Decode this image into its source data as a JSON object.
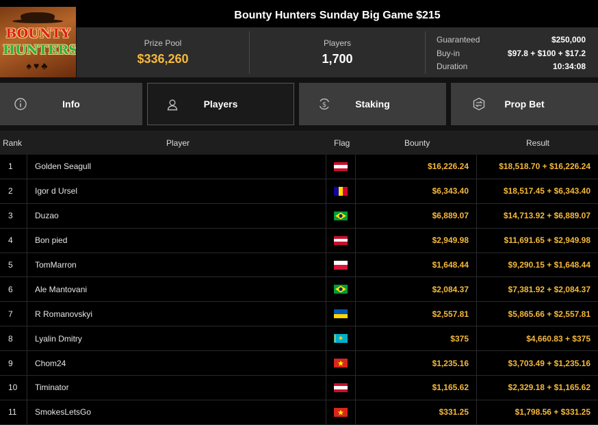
{
  "header": {
    "title": "Bounty Hunters Sunday Big Game $215",
    "logo_line1": "BOUNTY",
    "logo_line2": "HUNTERS"
  },
  "stats": {
    "prize_pool_label": "Prize Pool",
    "prize_pool_value": "$336,260",
    "players_label": "Players",
    "players_value": "1,700",
    "guaranteed_label": "Guaranteed",
    "guaranteed_value": "$250,000",
    "buyin_label": "Buy-in",
    "buyin_value": "$97.8 + $100 + $17.2",
    "duration_label": "Duration",
    "duration_value": "10:34:08"
  },
  "tabs": [
    {
      "label": "Info",
      "icon": "info-icon",
      "active": false
    },
    {
      "label": "Players",
      "icon": "user-icon",
      "active": true
    },
    {
      "label": "Staking",
      "icon": "coin-cycle-icon",
      "active": false
    },
    {
      "label": "Prop Bet",
      "icon": "prop-bet-icon",
      "active": false
    }
  ],
  "table": {
    "headers": {
      "rank": "Rank",
      "player": "Player",
      "flag": "Flag",
      "bounty": "Bounty",
      "result": "Result"
    },
    "rows": [
      {
        "rank": "1",
        "player": "Golden Seagull",
        "flag": "austria",
        "bounty": "$16,226.24",
        "result": "$18,518.70 + $16,226.24"
      },
      {
        "rank": "2",
        "player": "Igor d Ursel",
        "flag": "andorra",
        "bounty": "$6,343.40",
        "result": "$18,517.45 + $6,343.40"
      },
      {
        "rank": "3",
        "player": "Duzao",
        "flag": "brazil",
        "bounty": "$6,889.07",
        "result": "$14,713.92 + $6,889.07"
      },
      {
        "rank": "4",
        "player": "Bon pied",
        "flag": "austria",
        "bounty": "$2,949.98",
        "result": "$11,691.65 + $2,949.98"
      },
      {
        "rank": "5",
        "player": "TomMarron",
        "flag": "poland",
        "bounty": "$1,648.44",
        "result": "$9,290.15 + $1,648.44"
      },
      {
        "rank": "6",
        "player": "Ale Mantovani",
        "flag": "brazil",
        "bounty": "$2,084.37",
        "result": "$7,381.92 + $2,084.37"
      },
      {
        "rank": "7",
        "player": "R Romanovskyi",
        "flag": "ukraine",
        "bounty": "$2,557.81",
        "result": "$5,865.66 + $2,557.81"
      },
      {
        "rank": "8",
        "player": "Lyalin Dmitry",
        "flag": "kazakhstan",
        "bounty": "$375",
        "result": "$4,660.83 + $375"
      },
      {
        "rank": "9",
        "player": "Chom24",
        "flag": "vietnam",
        "bounty": "$1,235.16",
        "result": "$3,703.49 + $1,235.16"
      },
      {
        "rank": "10",
        "player": "Timinator",
        "flag": "austria",
        "bounty": "$1,165.62",
        "result": "$2,329.18 + $1,165.62"
      },
      {
        "rank": "11",
        "player": "SmokesLetsGo",
        "flag": "vietnam",
        "bounty": "$331.25",
        "result": "$1,798.56 + $331.25"
      }
    ]
  },
  "colors": {
    "accent_gold": "#f6b93b",
    "panel": "#2c2c2c",
    "tab": "#3c3c3c",
    "row_bg": "#000000"
  }
}
